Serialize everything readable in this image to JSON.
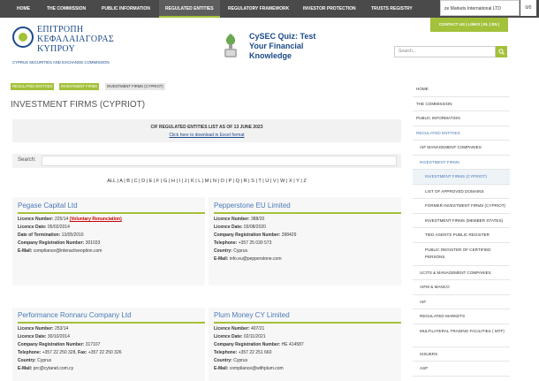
{
  "topnav": {
    "items": [
      "HOME",
      "THE COMMISSION",
      "PUBLIC INFORMATION",
      "REGULATED ENTITIES",
      "REGULATORY FRAMEWORK",
      "INVESTOR PROTECTION",
      "TRUSTS REGISTRY"
    ],
    "active_index": 3,
    "tooltip": "ze Markets International LTD",
    "counter": "0/0"
  },
  "contact": {
    "label": "CONTACT US | LINKS | EL | EN |"
  },
  "logo": {
    "line1": "ΕΠΙΤΡΟΠΗ",
    "line2": "ΚΕΦΑΛΑΙΑΓΟΡΑΣ",
    "line3": "ΚΥΠΡΟΥ",
    "subtitle": "CYPRUS SECURITIES AND EXCHANGE COMMISSION"
  },
  "quiz": {
    "line1": "CySEC Quiz: Test",
    "line2": "Your Financial",
    "line3": "Knowledge"
  },
  "search": {
    "placeholder": "Search..."
  },
  "breadcrumb": [
    "REGULATED ENTITIES",
    "INVESTMENT FIRMS",
    "INVESTMENT FIRMS (CYPRIOT)"
  ],
  "page_title": "INVESTMENT FIRMS (CYPRIOT)",
  "panel": {
    "heading": "CIF REGULATED ENTITIES LIST AS OF 13 JUNE 2023",
    "download": "Click here to download in Excel format"
  },
  "search_label": "Search:",
  "alphabet": "ALL | A | B | C | D | E | F | G | H | I | J | K | L | M | N | O | P | Q | R | S | T | U | V | W | X | Y | Z",
  "cards": [
    {
      "name": "Pegase Capital Ltd",
      "licence_label": "Licence Number:",
      "licence": "225/14",
      "licence_note": "(Voluntary Renunciation)",
      "date_label": "Licence Date:",
      "date": "05/02/2014",
      "term_label": "Date of Termination:",
      "term": "13/05/2016",
      "reg_label": "Company Registration Number:",
      "reg": "301033",
      "email_label": "E-Mail:",
      "email": "compliance@interactiveoption.com"
    },
    {
      "name": "Pepperstone EU Limited",
      "licence_label": "Licence Number:",
      "licence": "388/20",
      "date_label": "Licence Date:",
      "date": "03/08/2020",
      "reg_label": "Company Registration Number:",
      "reg": "398429",
      "tel_label": "Telephone:",
      "tel": "+357 25 030 573",
      "country_label": "Country:",
      "country": "Cyprus",
      "email_label": "E-Mail:",
      "email": "info.eu@pepperstone.com"
    },
    {
      "name": "Performance Ronnaru Company Ltd",
      "licence_label": "Licence Number:",
      "licence": "253/14",
      "date_label": "Licence Date:",
      "date": "30/10/2014",
      "reg_label": "Company Registration Number:",
      "reg": "317107",
      "tel_label": "Telephone:",
      "tel": "+357 22 250 328",
      "fax_label": "Fax:",
      "fax": "+357 22 250 326",
      "country_label": "Country:",
      "country": "Cyprus",
      "email_label": "E-Mail:",
      "email": "prc@cytanet.com.cy"
    },
    {
      "name": "Plum Money CY Limited",
      "licence_label": "Licence Number:",
      "licence": "407/21",
      "date_label": "Licence Date:",
      "date": "02/11/2021",
      "reg_label": "Company Registration Number:",
      "reg": "HE 414587",
      "tel_label": "Telephone:",
      "tel": "+357 22 251 660",
      "country_label": "Country:",
      "country": "Cyprus",
      "email_label": "E-Mail:",
      "email": "compliance@withplum.com"
    }
  ],
  "sidebar": [
    {
      "label": "HOME",
      "level": 1
    },
    {
      "label": "THE COMMISSION",
      "level": 1
    },
    {
      "label": "PUBLIC INFORMATION",
      "level": 1
    },
    {
      "label": "REGULATED ENTITIES",
      "level": 1,
      "state": "active"
    },
    {
      "label": "AIF MANAGEMENT COMPANIES",
      "level": 2
    },
    {
      "label": "INVESTMENT FIRMS",
      "level": 2,
      "state": "active"
    },
    {
      "label": "INVESTMENT FIRMS (CYPRIOT)",
      "level": 3,
      "state": "current"
    },
    {
      "label": "LIST OF APPROVED DOMAINS",
      "level": 3
    },
    {
      "label": "FORMER INVESTMENT FIRMS (CYPRIOT)",
      "level": 3
    },
    {
      "label": "INVESTMENT FIRMS (MEMBER STATES)",
      "level": 3
    },
    {
      "label": "TIED AGENTS PUBLIC REGISTER",
      "level": 3
    },
    {
      "label": "PUBLIC REGISTER OF CERTIFIED PERSONS",
      "level": 3,
      "tall": true
    },
    {
      "label": "UCITS & MANAGEMENT COMPANIES",
      "level": 2
    },
    {
      "label": "AIFM & MANCO",
      "level": 2
    },
    {
      "label": "AIF",
      "level": 2
    },
    {
      "label": "REGULATED MARKETS",
      "level": 2
    },
    {
      "label": "MULTILATERAL TRADING FACILITIES ( MTF)",
      "level": 2,
      "tall": true
    },
    {
      "label": "ISSUERS",
      "level": 2
    },
    {
      "label": "ASP",
      "level": 2
    }
  ],
  "colors": {
    "accent": "#a3c13a",
    "link": "#4a7bb7",
    "brand": "#1a4a8a",
    "nav_bg": "#4a4a4a"
  }
}
